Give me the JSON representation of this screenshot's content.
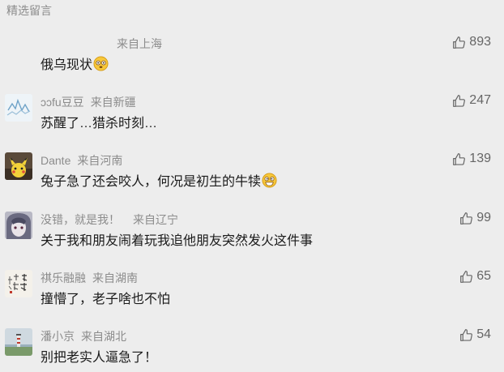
{
  "section": {
    "title": "精选留言"
  },
  "comments": [
    {
      "nickname": "",
      "location": "来自上海",
      "text": "俄乌现状",
      "emoji": "flushed-emoji",
      "likes": "893"
    },
    {
      "nickname": "ɔɔfu豆豆",
      "location": "来自新疆",
      "text": "苏醒了…猎杀时刻…",
      "emoji": "",
      "likes": "247"
    },
    {
      "nickname": "Dante",
      "location": "来自河南",
      "text": "兔子急了还会咬人，何况是初生的牛犊",
      "emoji": "grin-emoji",
      "likes": "139"
    },
    {
      "nickname": "没错，就是我！",
      "location": "来自辽宁",
      "text": "关于我和朋友闹着玩我追他朋友突然发火这件事",
      "emoji": "",
      "likes": "99"
    },
    {
      "nickname": "祺乐融融",
      "location": "来自湖南",
      "text": "撞懵了，老子啥也不怕",
      "emoji": "",
      "likes": "65"
    },
    {
      "nickname": "潘小京",
      "location": "来自湖北",
      "text": "别把老实人逼急了！",
      "emoji": "",
      "likes": "54"
    }
  ],
  "icons": {
    "like": "thumbs-up-icon"
  },
  "colors": {
    "background": "#ededed",
    "meta": "#8c8c8c",
    "text": "#1a1a1a",
    "like": "#666666"
  }
}
